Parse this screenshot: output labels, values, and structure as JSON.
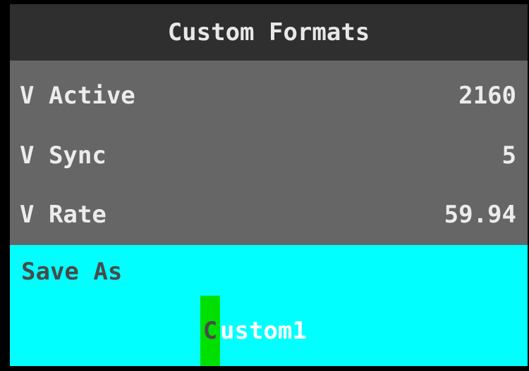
{
  "title": "Custom Formats",
  "rows": [
    {
      "label": "V Active",
      "value": "2160"
    },
    {
      "label": "V Sync",
      "value": "5"
    },
    {
      "label": "V Rate",
      "value": "59.94"
    }
  ],
  "save": {
    "label": "Save As",
    "name_cursor_char": "C",
    "name_rest": "ustom1"
  },
  "colors": {
    "title_bg": "#2f2f2f",
    "rows_bg": "#666666",
    "save_bg": "#00ffff",
    "cursor_bg": "#00e000"
  }
}
